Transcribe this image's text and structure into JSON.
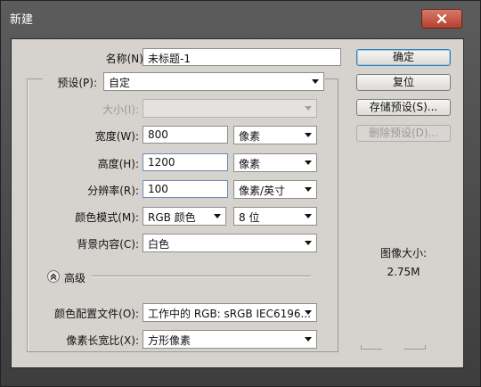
{
  "window": {
    "title": "新建"
  },
  "fields": {
    "name": {
      "label": "名称(N):",
      "value": "未标题-1"
    },
    "preset": {
      "label": "预设(P):",
      "value": "自定"
    },
    "size": {
      "label": "大小(I):",
      "value": ""
    },
    "width": {
      "label": "宽度(W):",
      "value": "800",
      "unit": "像素"
    },
    "height": {
      "label": "高度(H):",
      "value": "1200",
      "unit": "像素"
    },
    "resolution": {
      "label": "分辨率(R):",
      "value": "100",
      "unit": "像素/英寸"
    },
    "color_mode": {
      "label": "颜色模式(M):",
      "value": "RGB 颜色",
      "depth": "8 位"
    },
    "background": {
      "label": "背景内容(C):",
      "value": "白色"
    }
  },
  "advanced": {
    "label": "高级",
    "color_profile": {
      "label": "颜色配置文件(O):",
      "value": "工作中的 RGB: sRGB IEC6196..."
    },
    "pixel_aspect": {
      "label": "像素长宽比(X):",
      "value": "方形像素"
    }
  },
  "buttons": {
    "ok": "确定",
    "reset": "复位",
    "save_preset": "存储预设(S)...",
    "delete_preset": "删除预设(D)..."
  },
  "image_size": {
    "label": "图像大小:",
    "value": "2.75M"
  },
  "colors": {
    "accent": "#3c7fb1",
    "close": "#c2493a",
    "dialog_bg": "#d6d3ce"
  }
}
